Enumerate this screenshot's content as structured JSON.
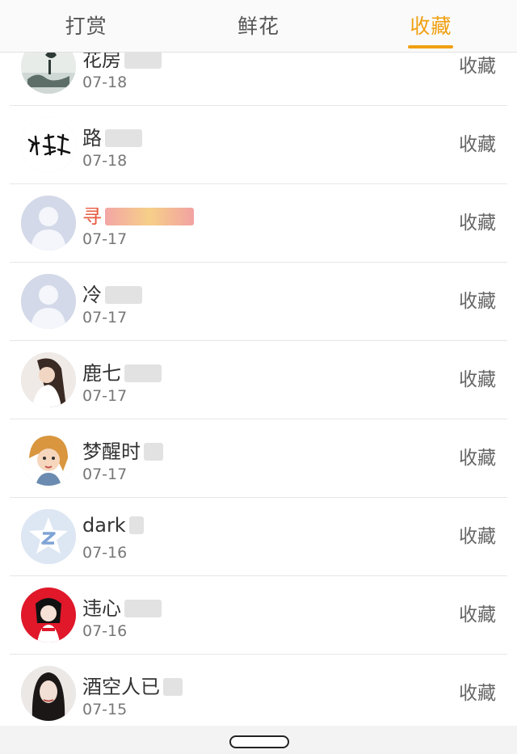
{
  "tabs": [
    {
      "label": "打赏",
      "active": false
    },
    {
      "label": "鲜花",
      "active": false
    },
    {
      "label": "收藏",
      "active": true
    }
  ],
  "accent_color": "#f0a013",
  "rows": [
    {
      "name": "花房",
      "date": "07-18",
      "action": "收藏",
      "avatar": "landscape-photo-avatar"
    },
    {
      "name": "路",
      "date": "07-18",
      "action": "收藏",
      "avatar": "calligraphy-avatar"
    },
    {
      "name": "寻",
      "date": "07-17",
      "action": "收藏",
      "avatar": "default-person-avatar"
    },
    {
      "name": "冷",
      "date": "07-17",
      "action": "收藏",
      "avatar": "default-person-avatar"
    },
    {
      "name": "鹿七",
      "date": "07-17",
      "action": "收藏",
      "avatar": "girl-photo-avatar"
    },
    {
      "name": "梦醒时",
      "date": "07-17",
      "action": "收藏",
      "avatar": "cartoon-girl-avatar"
    },
    {
      "name": "dark",
      "date": "07-16",
      "action": "收藏",
      "avatar": "qq-star-avatar"
    },
    {
      "name": "违心",
      "date": "07-16",
      "action": "收藏",
      "avatar": "red-anime-avatar"
    },
    {
      "name": "酒空人已",
      "date": "07-15",
      "action": "收藏",
      "avatar": "dark-hair-girl-avatar"
    }
  ]
}
